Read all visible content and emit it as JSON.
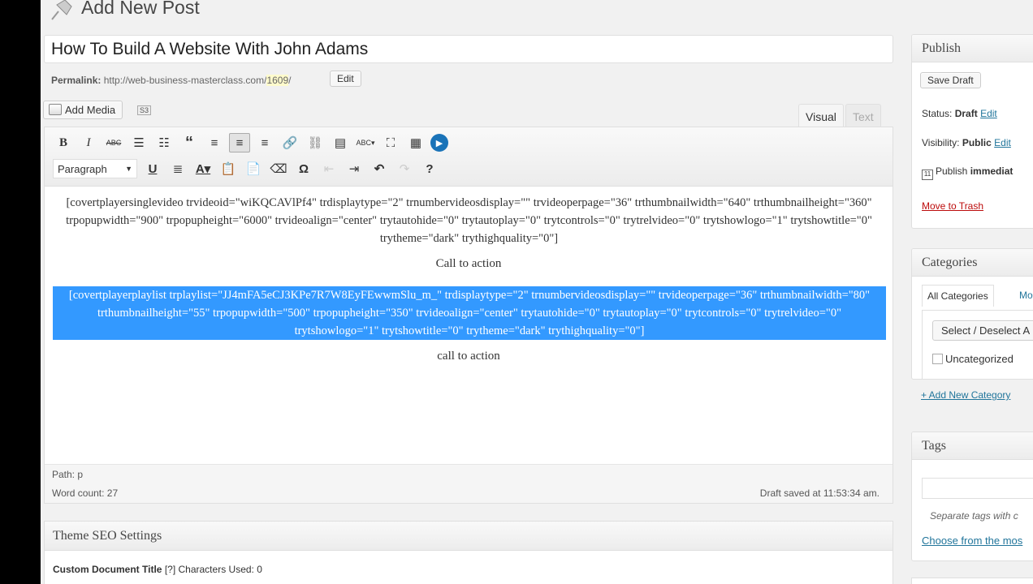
{
  "header": {
    "title": "Add New Post",
    "icon": "pushpin-icon"
  },
  "post": {
    "title": "How To Build A Website With John Adams",
    "permalink_label": "Permalink:",
    "permalink_base": "http://web-business-masterclass.com/",
    "permalink_slug": "1609",
    "permalink_trail": "/",
    "edit_label": "Edit"
  },
  "media": {
    "add_media_label": "Add Media",
    "s3_label": "S3"
  },
  "editor_tabs": {
    "visual": "Visual",
    "text": "Text"
  },
  "toolbar": {
    "row1": [
      "bold",
      "italic",
      "strikethrough",
      "bullet-list",
      "numbered-list",
      "blockquote",
      "align-left",
      "align-center",
      "align-right",
      "insert-link",
      "unlink",
      "insert-more",
      "spellcheck",
      "fullscreen",
      "kitchen-sink",
      "video-player"
    ],
    "row2_format": "Paragraph",
    "row2": [
      "underline",
      "justify",
      "text-color",
      "paste-text",
      "paste-word",
      "clear-formatting",
      "special-character",
      "outdent",
      "indent",
      "undo",
      "redo",
      "help"
    ]
  },
  "content": {
    "shortcode1": "[covertplayersinglevideo trvideoid=\"wiKQCAVlPf4\" trdisplaytype=\"2\" trnumbervideosdisplay=\"\" trvideoperpage=\"36\" trthumbnailwidth=\"640\" trthumbnailheight=\"360\" trpopupwidth=\"900\" trpopupheight=\"6000\" trvideoalign=\"center\" trytautohide=\"0\" trytautoplay=\"0\" trytcontrols=\"0\" trytrelvideo=\"0\" trytshowlogo=\"1\" trytshowtitle=\"0\" trytheme=\"dark\" trythighquality=\"0\"]",
    "cta1": "Call to action",
    "shortcode2": "[covertplayerplaylist trplaylist=\"JJ4mFA5eCJ3KPe7R7W8EyFEwwmSlu_m_\" trdisplaytype=\"2\" trnumbervideosdisplay=\"\" trvideoperpage=\"36\" trthumbnailwidth=\"80\" trthumbnailheight=\"55\" trpopupwidth=\"500\" trpopupheight=\"350\" trvideoalign=\"center\" trytautohide=\"0\" trytautoplay=\"0\" trytcontrols=\"0\" trytrelvideo=\"0\" trytshowlogo=\"1\" trytshowtitle=\"0\" trytheme=\"dark\" trythighquality=\"0\"]",
    "cta2": "call to action"
  },
  "status_bar": {
    "path": "Path: p",
    "word_count": "Word count: 27",
    "saved": "Draft saved at 11:53:34 am."
  },
  "seo": {
    "title": "Theme SEO Settings",
    "field_label": "Custom Document Title",
    "help": "[?]",
    "chars": "Characters Used: 0"
  },
  "publish": {
    "title": "Publish",
    "save_draft": "Save Draft",
    "status_label": "Status:",
    "status_value": "Draft",
    "visibility_label": "Visibility:",
    "visibility_value": "Public",
    "edit": "Edit",
    "publish_label": "Publish",
    "publish_value": "immediat",
    "trash": "Move to Trash"
  },
  "categories": {
    "title": "Categories",
    "tab_all": "All Categories",
    "tab_most": "Mos",
    "select_button": "Select / Deselect A",
    "item": "Uncategorized",
    "add_new": "+ Add New Category"
  },
  "tags": {
    "title": "Tags",
    "hint": "Separate tags with c",
    "choose": "Choose from the mos"
  },
  "colors": {
    "selection": "#3399ff",
    "link": "#21759b",
    "trash": "#bc0b0b",
    "play": "#1a73b8"
  }
}
